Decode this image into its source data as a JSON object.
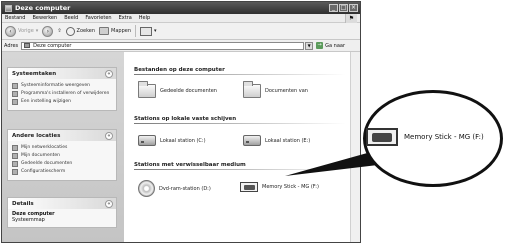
{
  "window": {
    "title": "Deze computer",
    "controls": [
      "_",
      "□",
      "×"
    ]
  },
  "menu": [
    "Bestand",
    "Bewerken",
    "Beeld",
    "Favorieten",
    "Extra",
    "Help"
  ],
  "toolbar": {
    "back": "Vorige",
    "search": "Zoeken",
    "folders": "Mappen"
  },
  "address": {
    "label": "Adres",
    "value": "Deze computer",
    "go": "Ga naar"
  },
  "taskpane": {
    "system": {
      "title": "Systeemtaken",
      "items": [
        "Systeeminformatie weergeven",
        "Programma's installeren of verwijderen",
        "Een instelling wijzigen"
      ]
    },
    "other": {
      "title": "Andere locaties",
      "items": [
        "Mijn netwerklocaties",
        "Mijn documenten",
        "Gedeelde documenten",
        "Configuratiescherm"
      ]
    },
    "details": {
      "title": "Details",
      "name": "Deze computer",
      "type": "Systeemmap"
    }
  },
  "groups": {
    "files": {
      "title": "Bestanden op deze computer",
      "items": [
        "Gedeelde documenten",
        "Documenten van"
      ]
    },
    "hdd": {
      "title": "Stations op lokale vaste schijven",
      "items": [
        "Lokaal station (C:)",
        "Lokaal station (E:)"
      ]
    },
    "removable": {
      "title": "Stations met verwisselbaar medium",
      "items": [
        "Dvd-ram-station (D:)",
        "Memory Stick - MG (F:)"
      ]
    }
  },
  "callout": {
    "label": "Memory Stick - MG (F:)"
  }
}
